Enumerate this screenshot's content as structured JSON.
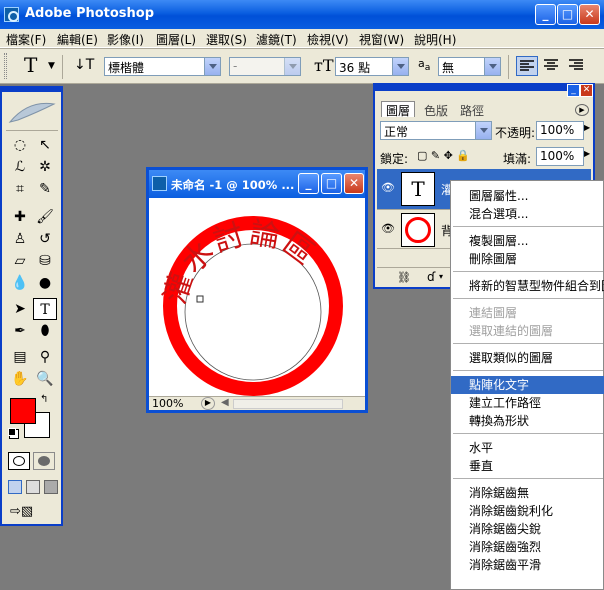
{
  "app": {
    "title": "Adobe Photoshop"
  },
  "menubar": [
    "檔案(F)",
    "編輯(E)",
    "影像(I)",
    "圖層(L)",
    "選取(S)",
    "濾鏡(T)",
    "檢視(V)",
    "視窗(W)",
    "說明(H)"
  ],
  "options": {
    "tool_letter": "T",
    "font_family": "標楷體",
    "font_style": "-",
    "font_size": "36 點",
    "aa_label": "a",
    "aa_value": "無"
  },
  "document": {
    "title": "未命名 -1 @ 100% ...",
    "zoom": "100%",
    "arc_text": "灌水討論區",
    "circle_color": "#ff0000"
  },
  "layers_panel": {
    "tabs": [
      "圖層",
      "色版",
      "路徑"
    ],
    "blend_mode": "正常",
    "opacity_label": "不透明:",
    "opacity_value": "100%",
    "lock_label": "鎖定:",
    "fill_label": "填滿:",
    "fill_value": "100%",
    "layer1_thumb": "T",
    "layer1_name": "灌",
    "layer2_name": "背"
  },
  "context_menu": {
    "items": [
      {
        "label": "圖層屬性...",
        "disabled": false
      },
      {
        "label": "混合選項...",
        "disabled": false
      },
      {
        "label": "複製圖層...",
        "disabled": false
      },
      {
        "label": "刪除圖層",
        "disabled": false
      },
      {
        "label": "將新的智慧型物件組合到圖",
        "disabled": false
      },
      {
        "label": "連結圖層",
        "disabled": true
      },
      {
        "label": "選取連結的圖層",
        "disabled": true
      },
      {
        "label": "選取類似的圖層",
        "disabled": false
      },
      {
        "label": "點陣化文字",
        "disabled": false,
        "highlight": true
      },
      {
        "label": "建立工作路徑",
        "disabled": false
      },
      {
        "label": "轉換為形狀",
        "disabled": false
      },
      {
        "label": "水平",
        "disabled": false
      },
      {
        "label": "垂直",
        "disabled": false
      },
      {
        "label": "消除鋸齒無",
        "disabled": false
      },
      {
        "label": "消除鋸齒銳利化",
        "disabled": false
      },
      {
        "label": "消除鋸齒尖銳",
        "disabled": false
      },
      {
        "label": "消除鋸齒強烈",
        "disabled": false
      },
      {
        "label": "消除鋸齒平滑",
        "disabled": false
      }
    ]
  },
  "colors": {
    "foreground": "#ff0000",
    "background": "#ffffff",
    "xp_blue": "#0a5ee0"
  }
}
